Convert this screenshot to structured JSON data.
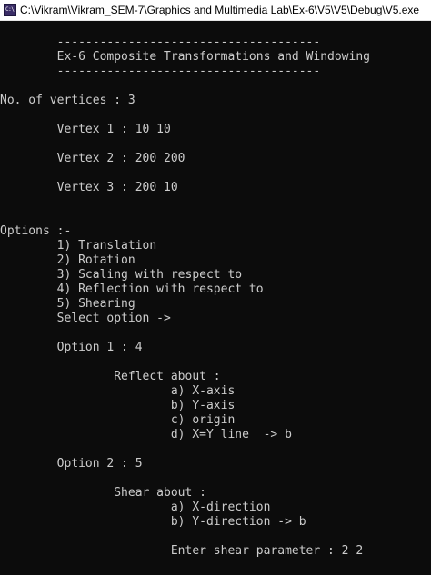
{
  "window": {
    "title": "C:\\Vikram\\Vikram_SEM-7\\Graphics and Multimedia Lab\\Ex-6\\V5\\V5\\Debug\\V5.exe",
    "icon": "console-app-icon",
    "icon_text": "C:\\"
  },
  "colors": {
    "background": "#0c0c0c",
    "text": "#cccccc",
    "titlebar": "#ffffff"
  },
  "console": {
    "lines": [
      "        -------------------------------------",
      "        Ex-6 Composite Transformations and Windowing",
      "        -------------------------------------",
      "",
      "No. of vertices : 3",
      "",
      "        Vertex 1 : 10 10",
      "",
      "        Vertex 2 : 200 200",
      "",
      "        Vertex 3 : 200 10",
      "",
      "",
      "Options :-",
      "        1) Translation",
      "        2) Rotation",
      "        3) Scaling with respect to",
      "        4) Reflection with respect to",
      "        5) Shearing",
      "        Select option ->",
      "",
      "        Option 1 : 4",
      "",
      "                Reflect about :",
      "                        a) X-axis",
      "                        b) Y-axis",
      "                        c) origin",
      "                        d) X=Y line  -> b",
      "",
      "        Option 2 : 5",
      "",
      "                Shear about :",
      "                        a) X-direction",
      "                        b) Y-direction -> b",
      "",
      "                        Enter shear parameter : 2 2"
    ]
  }
}
